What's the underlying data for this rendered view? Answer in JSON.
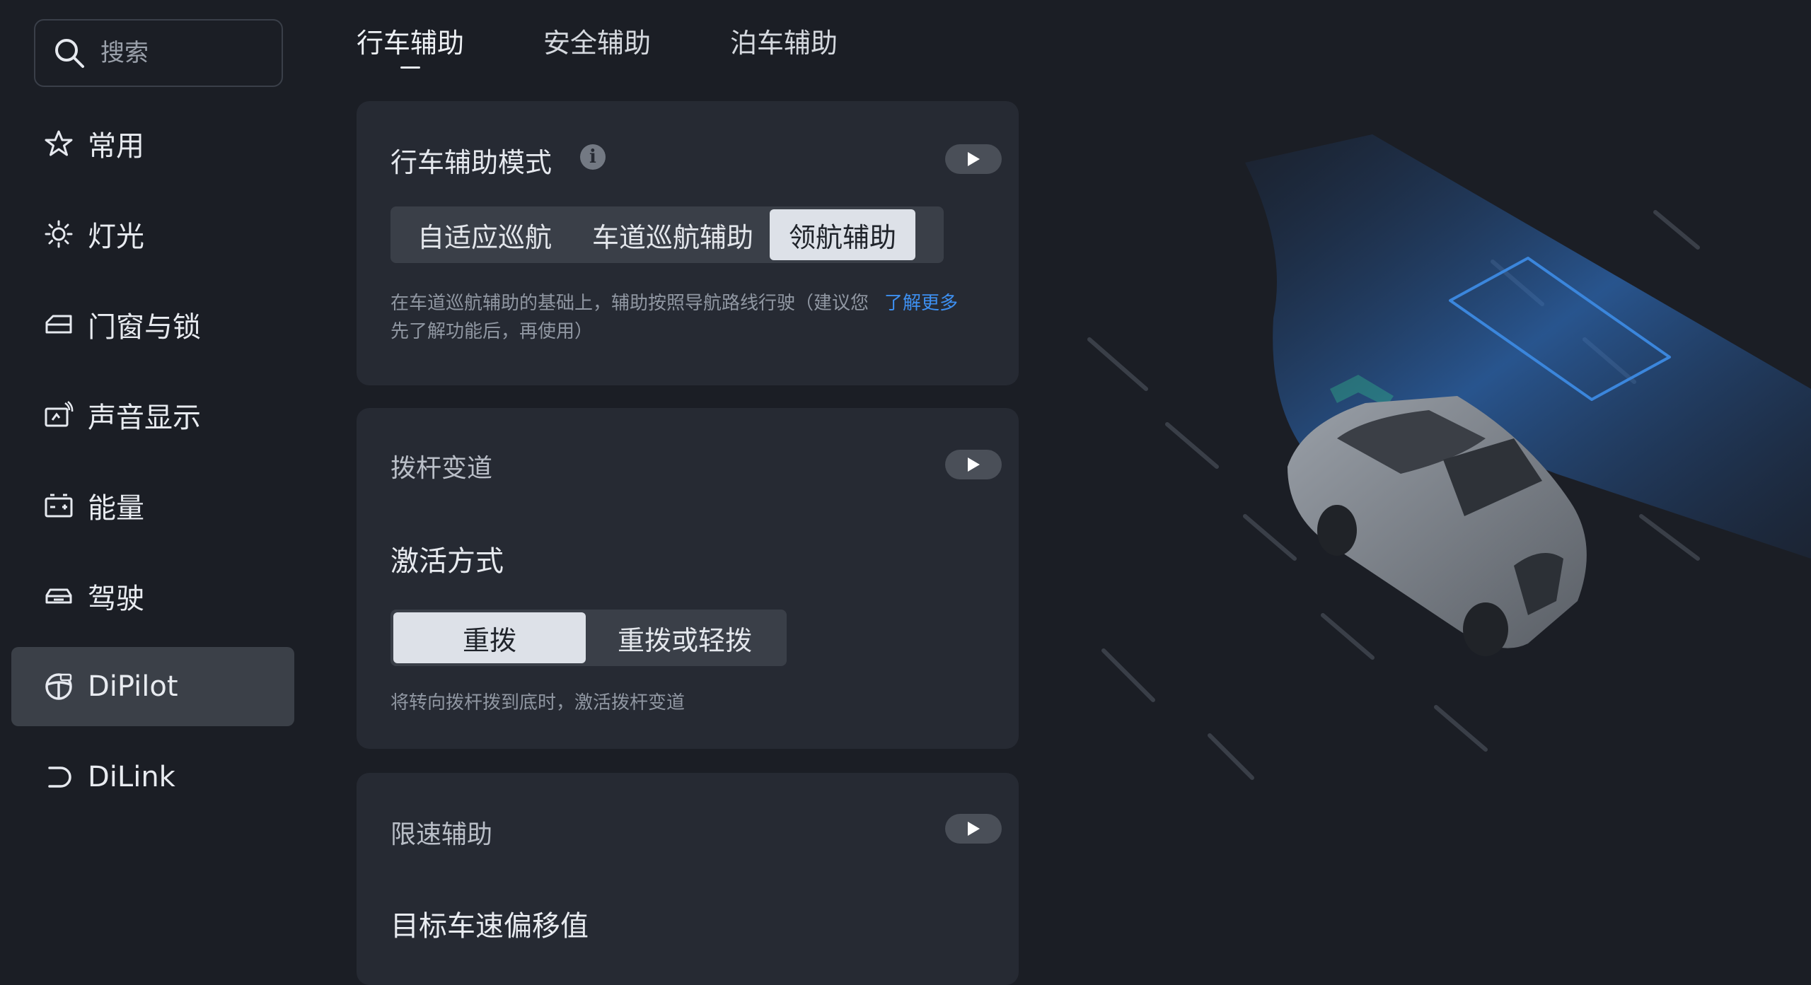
{
  "search": {
    "placeholder": "搜索"
  },
  "sidebar": {
    "items": [
      {
        "label": "常用",
        "icon": "star-icon"
      },
      {
        "label": "灯光",
        "icon": "sun-icon"
      },
      {
        "label": "门窗与锁",
        "icon": "car-door-icon"
      },
      {
        "label": "声音显示",
        "icon": "display-sound-icon"
      },
      {
        "label": "能量",
        "icon": "battery-icon"
      },
      {
        "label": "驾驶",
        "icon": "car-icon"
      },
      {
        "label": "DiPilot",
        "icon": "steering-wheel-icon",
        "active": true
      },
      {
        "label": "DiLink",
        "icon": "dilink-icon"
      }
    ]
  },
  "tabs": [
    {
      "label": "行车辅助",
      "active": true
    },
    {
      "label": "安全辅助"
    },
    {
      "label": "泊车辅助"
    }
  ],
  "cards": {
    "mode": {
      "title": "行车辅助模式",
      "options": [
        "自适应巡航",
        "车道巡航辅助",
        "领航辅助"
      ],
      "selected": "领航辅助",
      "description_line1": "在车道巡航辅助的基础上，辅助按照导航路线行驶（建议您",
      "learn_more": "了解更多",
      "description_line2": "先了解功能后，再使用）"
    },
    "lane_change": {
      "title": "拨杆变道",
      "subheading": "激活方式",
      "options": [
        "重拨",
        "重拨或轻拨"
      ],
      "selected": "重拨",
      "description": "将转向拨杆拨到底时，激活拨杆变道"
    },
    "speed_limit": {
      "title": "限速辅助",
      "subheading": "目标车速偏移值"
    }
  },
  "colors": {
    "background": "#1b1e25",
    "card": "#262a33",
    "active_nav": "#3b4048",
    "selected_segment": "#dde1e8",
    "link": "#3d8ff0",
    "lane_blue": "#2f6fc0",
    "chevron_green": "#2fb08a"
  }
}
